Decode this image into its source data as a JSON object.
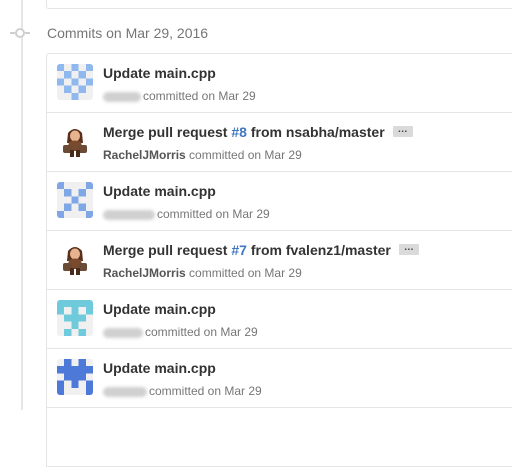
{
  "group": {
    "title": "Commits on Mar 29, 2016"
  },
  "colors": {
    "link": "#4078c0",
    "muted": "#767676",
    "border": "#e5e5e5"
  },
  "commits": [
    {
      "message": "Update main.cpp",
      "committed_label": "committed on Mar 29",
      "avatar_icon": "identicon-avatar",
      "avatar_color": "#8fb9ee"
    },
    {
      "message_prefix": "Merge pull request ",
      "pr": "#8",
      "message_suffix": " from nsabha/master",
      "author": "RachelJMorris",
      "committed_label": "committed on Mar 29",
      "avatar_icon": "user-avatar",
      "ellipsis": "…"
    },
    {
      "message": "Update main.cpp",
      "committed_label": "committed on Mar 29",
      "avatar_icon": "identicon-avatar",
      "avatar_color": "#7fa6e6"
    },
    {
      "message_prefix": "Merge pull request ",
      "pr": "#7",
      "message_suffix": " from fvalenz1/master",
      "author": "RachelJMorris",
      "committed_label": "committed on Mar 29",
      "avatar_icon": "user-avatar",
      "ellipsis": "…"
    },
    {
      "message": "Update main.cpp",
      "committed_label": "committed on Mar 29",
      "avatar_icon": "identicon-avatar",
      "avatar_color": "#6fcbdc"
    },
    {
      "message": "Update main.cpp",
      "committed_label": "committed on Mar 29",
      "avatar_icon": "identicon-avatar",
      "avatar_color": "#4d79d8"
    }
  ]
}
